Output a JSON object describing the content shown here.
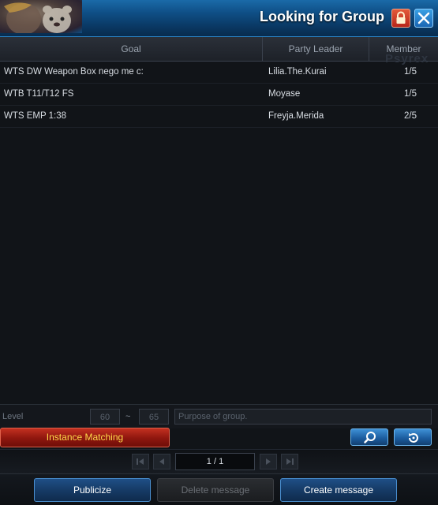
{
  "window": {
    "title": "Looking for Group"
  },
  "table": {
    "columns": [
      "Goal",
      "Party Leader",
      "Member"
    ],
    "rows": [
      {
        "goal": "WTS DW Weapon Box nego me c:",
        "leader": "Lilia.The.Kurai",
        "member": "1/5"
      },
      {
        "goal": "WTB T11/T12 FS",
        "leader": "Moyase",
        "member": "1/5"
      },
      {
        "goal": "WTS EMP 1:38",
        "leader": "Freyja.Merida",
        "member": "2/5"
      }
    ],
    "watermark": "Psyrex"
  },
  "filter": {
    "level_label": "Level",
    "level_min": "60",
    "separator": "~",
    "level_max": "65",
    "purpose_placeholder": "Purpose of group."
  },
  "actions": {
    "instance_matching_label": "Instance Matching",
    "search_icon": "search-icon",
    "refresh_icon": "refresh-icon"
  },
  "pager": {
    "current": "1 / 1"
  },
  "buttons": {
    "publicize": "Publicize",
    "delete": "Delete message",
    "create": "Create message"
  },
  "colors": {
    "header_blue": "#0f4f86",
    "instance_red": "#8e160e",
    "instance_text": "#ffd84a",
    "lock_red": "#b8261a",
    "close_blue": "#1a66b4"
  }
}
